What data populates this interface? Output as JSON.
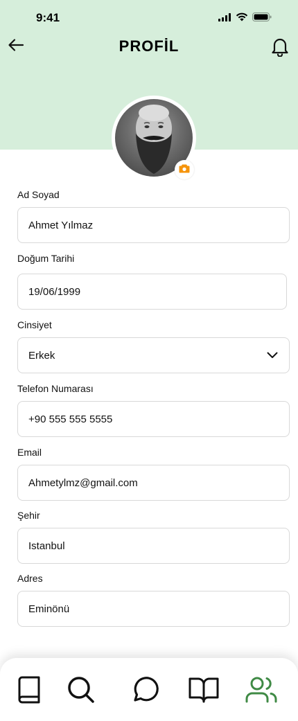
{
  "status": {
    "time": "9:41"
  },
  "header": {
    "title": "PROFİL"
  },
  "fields": {
    "name": {
      "label": "Ad Soyad",
      "value": "Ahmet Yılmaz"
    },
    "birth_date": {
      "label": "Doğum Tarihi",
      "value": "19/06/1999"
    },
    "gender": {
      "label": "Cinsiyet",
      "value": "Erkek"
    },
    "phone": {
      "label": "Telefon Numarası",
      "value": "+90 555 555 5555"
    },
    "email": {
      "label": "Email",
      "value": "Ahmetylmz@gmail.com"
    },
    "city": {
      "label": "Şehir",
      "value": "Istanbul"
    },
    "address": {
      "label": "Adres",
      "value": "Eminönü"
    }
  },
  "icons": {
    "back": "arrow-left-icon",
    "notifications": "bell-icon",
    "camera": "camera-icon",
    "dropdown": "chevron-down-icon",
    "tabs": [
      "book-icon",
      "search-icon",
      "chat-icon",
      "open-book-icon",
      "users-icon"
    ]
  },
  "colors": {
    "header_bg": "#d6eedb",
    "camera_accent": "#f5940c",
    "active_tab": "#3f8a45",
    "inactive_tab": "#111111",
    "field_border": "#d8d8d8"
  },
  "bottom_nav": {
    "active_index": 4
  }
}
